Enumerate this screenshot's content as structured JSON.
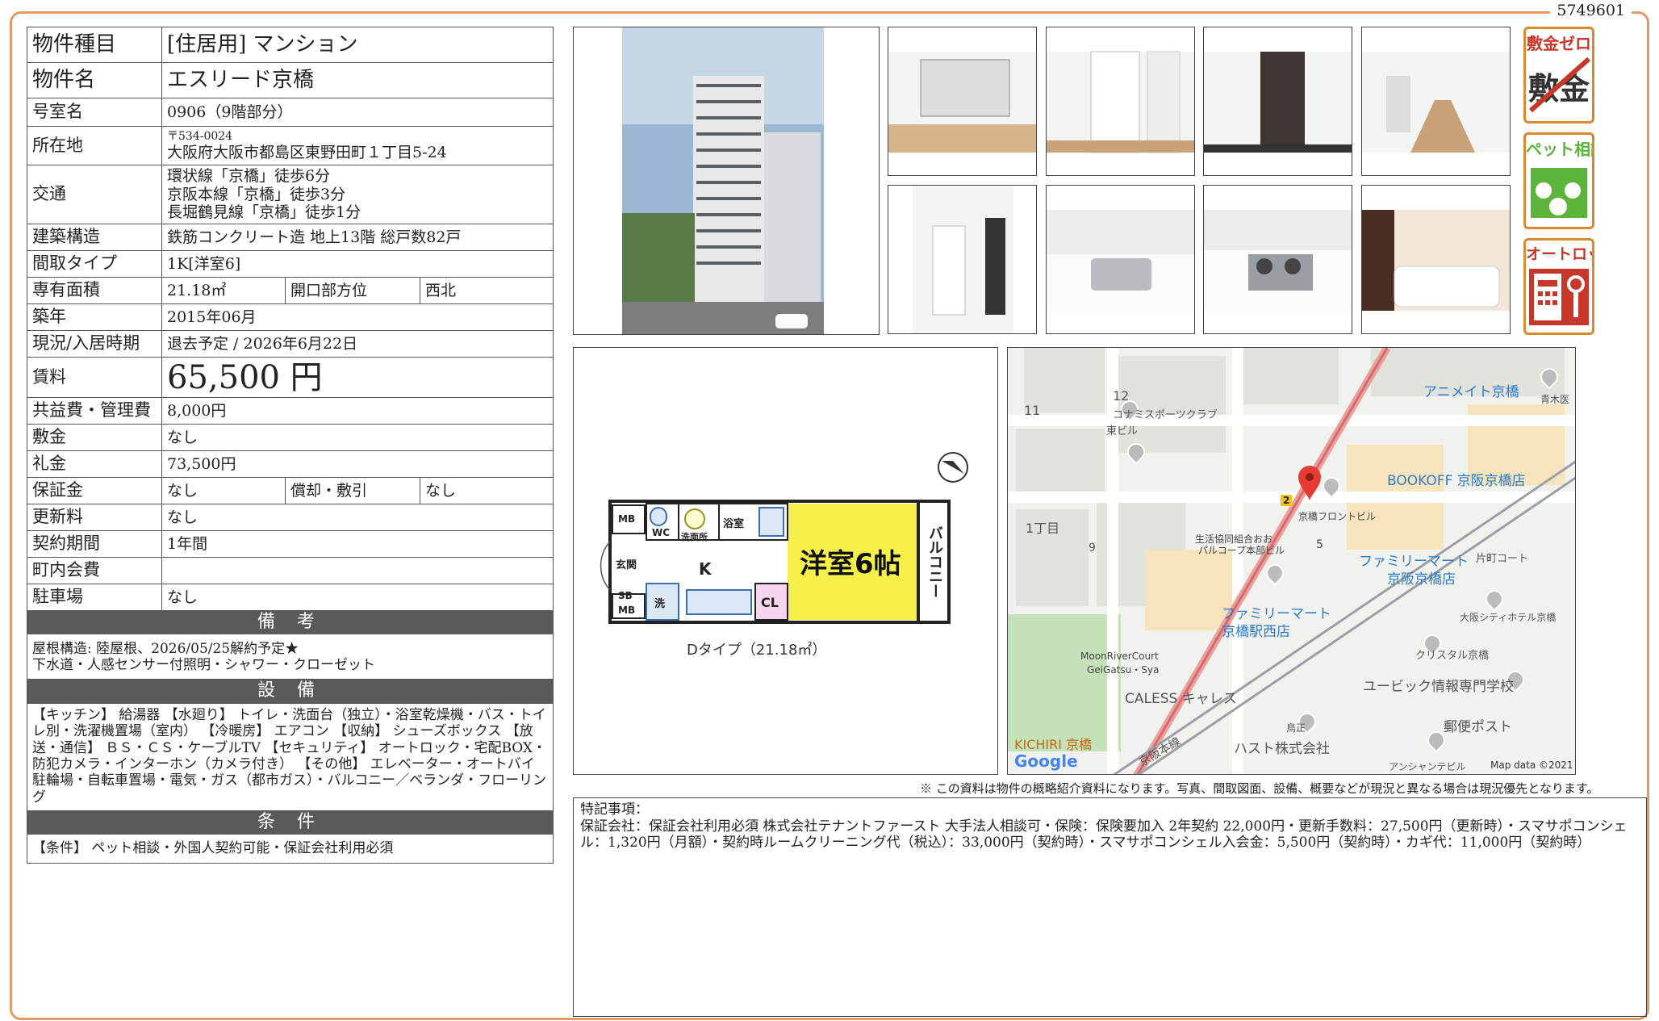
{
  "doc_id": "5749601",
  "spec": {
    "type_k": "物件種目",
    "type_v": "[住居用] マンション",
    "name_k": "物件名",
    "name_v": "エスリード京橋",
    "room_k": "号室名",
    "room_v": "0906（9階部分）",
    "addr_k": "所在地",
    "zip": "〒534-0024",
    "addr_v": "大阪府大阪市都島区東野田町１丁目5-24",
    "traffic_k": "交通",
    "traffic_1": "環状線「京橋」徒歩6分",
    "traffic_2": "京阪本線「京橋」徒歩3分",
    "traffic_3": "長堀鶴見線「京橋」徒歩1分",
    "struct_k": "建築構造",
    "struct_v": "鉄筋コンクリート造 地上13階 総戸数82戸",
    "layout_k": "間取タイプ",
    "layout_v": "1K[洋室6]",
    "area_k": "専有面積",
    "area_v": "21.18㎡",
    "open_k": "開口部方位",
    "open_v": "西北",
    "built_k": "築年",
    "built_v": "2015年06月",
    "status_k": "現況/入居時期",
    "status_v": "退去予定 / 2026年6月22日",
    "rent_k": "賃料",
    "rent_v": "65,500 円",
    "fee_k": "共益費・管理費",
    "fee_v": "8,000円",
    "deposit_k": "敷金",
    "deposit_v": "なし",
    "key_k": "礼金",
    "key_v": "73,500円",
    "guarantee_k": "保証金",
    "guarantee_v": "なし",
    "amort_k": "償却・敷引",
    "amort_v": "なし",
    "renew_k": "更新料",
    "renew_v": "なし",
    "term_k": "契約期間",
    "term_v": "1年間",
    "town_k": "町内会費",
    "town_v": "",
    "parking_k": "駐車場",
    "parking_v": "なし",
    "remarks_h": "備 考",
    "remarks_1": "屋根構造: 陸屋根、2026/05/25解約予定★",
    "remarks_2": "下水道・人感センサー付照明・シャワー・クローゼット",
    "equip_h": "設 備",
    "equip_v": "【キッチン】 給湯器 【水廻り】 トイレ・洗面台（独立）・浴室乾燥機・バス・トイレ別・洗濯機置場（室内） 【冷暖房】 エアコン 【収納】 シューズボックス 【放送・通信】 ＢＳ・ＣＳ・ケーブルTV 【セキュリティ】 オートロック・宅配BOX・防犯カメラ・インターホン（カメラ付き） 【その他】 エレベーター・オートバイ駐輪場・自転車置場・電気・ガス（都市ガス）・バルコニー／ベランダ・フローリング",
    "cond_h": "条 件",
    "cond_v": "【条件】 ペット相談・外国人契約可能・保証会社利用必須"
  },
  "badges": {
    "b1": "敷金ゼロ",
    "b1_icon": "敷金",
    "b2": "ペット相談",
    "b3": "オートロック"
  },
  "floorplan": {
    "room": "洋室6帖",
    "balcony": "バルコニー",
    "kitchen": "K",
    "closet": "CL",
    "bath": "浴室",
    "wash": "洗面所",
    "wc": "WC",
    "entrance": "玄関",
    "mb1": "MB",
    "mb2": "MB",
    "sb": "SB",
    "laundry": "洗",
    "caption": "Dタイプ（21.18㎡）"
  },
  "map": {
    "l1": "12",
    "l2": "コナミスポーツクラブ",
    "l3": "東ビル",
    "l4": "11",
    "l5": "1丁目",
    "l6": "9",
    "l7": "生活協同組合おお",
    "l8": "パルコープ本部ビル",
    "l9": "5",
    "l10": "京橋フロントビル",
    "l11": "アニメイト京橋",
    "l12": "青木医",
    "l13": "BOOKOFF 京阪京橋店",
    "l14": "ファミリーマート",
    "l15": "京阪京橋店",
    "l16": "片町コート",
    "l17": "大阪シティホテル京橋",
    "l18": "ファミリーマート",
    "l19": "京橋駅西店",
    "l20": "クリスタル京橋",
    "l21": "MoonRiverCourt",
    "l22": "GeiGatsu・Sya",
    "l23": "CALESS キャレス",
    "l24": "ユービック情報専門学校",
    "l25": "郵便ポスト",
    "l26": "鳥正",
    "l27": "ハスト株式会社",
    "l28": "KICHIRI 京橋",
    "l29": "京阪本線",
    "l30": "アンシャンテビル",
    "l31": "Google",
    "l32": "Map data ©2021",
    "l33": "2"
  },
  "disclaimer": "※ この資料は物件の概略紹介資料になります。写真、間取図面、設備、概要などが現況と異なる場合は現況優先となります。",
  "special": {
    "title": "特記事項：",
    "body": "保証会社：保証会社利用必須 株式会社テナントファースト 大手法人相談可・保険：保険要加入 2年契約 22,000円・更新手数料：27,500円（更新時）・スマサポコンシェル：1,320円（月額）・契約時ルームクリーニング代（税込）：33,000円（契約時）・スマサポコンシェル入会金：5,500円（契約時）・カギ代：11,000円（契約時）"
  },
  "colors": {
    "frame": "#e39a64",
    "header": "#5a5a5a",
    "room": "#f6f04a",
    "badge_border": "#d9892e",
    "badge_green": "#5cb43a",
    "badge_red": "#c8382a"
  }
}
